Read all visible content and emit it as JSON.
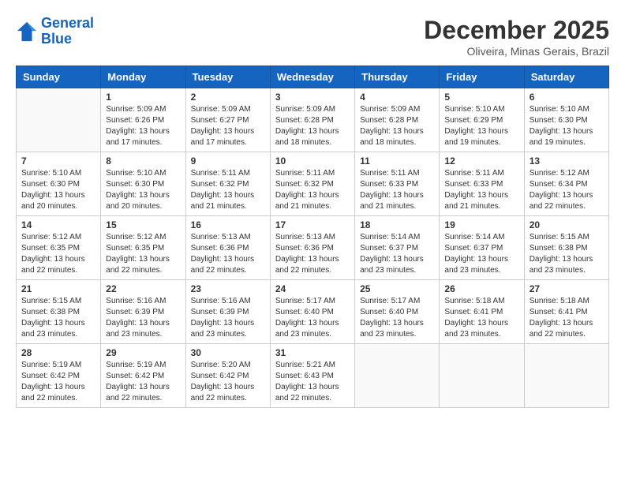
{
  "header": {
    "logo_line1": "General",
    "logo_line2": "Blue",
    "month": "December 2025",
    "location": "Oliveira, Minas Gerais, Brazil"
  },
  "weekdays": [
    "Sunday",
    "Monday",
    "Tuesday",
    "Wednesday",
    "Thursday",
    "Friday",
    "Saturday"
  ],
  "weeks": [
    [
      {
        "day": "",
        "sunrise": "",
        "sunset": "",
        "daylight": ""
      },
      {
        "day": "1",
        "sunrise": "Sunrise: 5:09 AM",
        "sunset": "Sunset: 6:26 PM",
        "daylight": "Daylight: 13 hours and 17 minutes."
      },
      {
        "day": "2",
        "sunrise": "Sunrise: 5:09 AM",
        "sunset": "Sunset: 6:27 PM",
        "daylight": "Daylight: 13 hours and 17 minutes."
      },
      {
        "day": "3",
        "sunrise": "Sunrise: 5:09 AM",
        "sunset": "Sunset: 6:28 PM",
        "daylight": "Daylight: 13 hours and 18 minutes."
      },
      {
        "day": "4",
        "sunrise": "Sunrise: 5:09 AM",
        "sunset": "Sunset: 6:28 PM",
        "daylight": "Daylight: 13 hours and 18 minutes."
      },
      {
        "day": "5",
        "sunrise": "Sunrise: 5:10 AM",
        "sunset": "Sunset: 6:29 PM",
        "daylight": "Daylight: 13 hours and 19 minutes."
      },
      {
        "day": "6",
        "sunrise": "Sunrise: 5:10 AM",
        "sunset": "Sunset: 6:30 PM",
        "daylight": "Daylight: 13 hours and 19 minutes."
      }
    ],
    [
      {
        "day": "7",
        "sunrise": "Sunrise: 5:10 AM",
        "sunset": "Sunset: 6:30 PM",
        "daylight": "Daylight: 13 hours and 20 minutes."
      },
      {
        "day": "8",
        "sunrise": "Sunrise: 5:10 AM",
        "sunset": "Sunset: 6:30 PM",
        "daylight": "Daylight: 13 hours and 20 minutes."
      },
      {
        "day": "9",
        "sunrise": "Sunrise: 5:11 AM",
        "sunset": "Sunset: 6:32 PM",
        "daylight": "Daylight: 13 hours and 21 minutes."
      },
      {
        "day": "10",
        "sunrise": "Sunrise: 5:11 AM",
        "sunset": "Sunset: 6:32 PM",
        "daylight": "Daylight: 13 hours and 21 minutes."
      },
      {
        "day": "11",
        "sunrise": "Sunrise: 5:11 AM",
        "sunset": "Sunset: 6:33 PM",
        "daylight": "Daylight: 13 hours and 21 minutes."
      },
      {
        "day": "12",
        "sunrise": "Sunrise: 5:11 AM",
        "sunset": "Sunset: 6:33 PM",
        "daylight": "Daylight: 13 hours and 21 minutes."
      },
      {
        "day": "13",
        "sunrise": "Sunrise: 5:12 AM",
        "sunset": "Sunset: 6:34 PM",
        "daylight": "Daylight: 13 hours and 22 minutes."
      }
    ],
    [
      {
        "day": "14",
        "sunrise": "Sunrise: 5:12 AM",
        "sunset": "Sunset: 6:35 PM",
        "daylight": "Daylight: 13 hours and 22 minutes."
      },
      {
        "day": "15",
        "sunrise": "Sunrise: 5:12 AM",
        "sunset": "Sunset: 6:35 PM",
        "daylight": "Daylight: 13 hours and 22 minutes."
      },
      {
        "day": "16",
        "sunrise": "Sunrise: 5:13 AM",
        "sunset": "Sunset: 6:36 PM",
        "daylight": "Daylight: 13 hours and 22 minutes."
      },
      {
        "day": "17",
        "sunrise": "Sunrise: 5:13 AM",
        "sunset": "Sunset: 6:36 PM",
        "daylight": "Daylight: 13 hours and 22 minutes."
      },
      {
        "day": "18",
        "sunrise": "Sunrise: 5:14 AM",
        "sunset": "Sunset: 6:37 PM",
        "daylight": "Daylight: 13 hours and 23 minutes."
      },
      {
        "day": "19",
        "sunrise": "Sunrise: 5:14 AM",
        "sunset": "Sunset: 6:37 PM",
        "daylight": "Daylight: 13 hours and 23 minutes."
      },
      {
        "day": "20",
        "sunrise": "Sunrise: 5:15 AM",
        "sunset": "Sunset: 6:38 PM",
        "daylight": "Daylight: 13 hours and 23 minutes."
      }
    ],
    [
      {
        "day": "21",
        "sunrise": "Sunrise: 5:15 AM",
        "sunset": "Sunset: 6:38 PM",
        "daylight": "Daylight: 13 hours and 23 minutes."
      },
      {
        "day": "22",
        "sunrise": "Sunrise: 5:16 AM",
        "sunset": "Sunset: 6:39 PM",
        "daylight": "Daylight: 13 hours and 23 minutes."
      },
      {
        "day": "23",
        "sunrise": "Sunrise: 5:16 AM",
        "sunset": "Sunset: 6:39 PM",
        "daylight": "Daylight: 13 hours and 23 minutes."
      },
      {
        "day": "24",
        "sunrise": "Sunrise: 5:17 AM",
        "sunset": "Sunset: 6:40 PM",
        "daylight": "Daylight: 13 hours and 23 minutes."
      },
      {
        "day": "25",
        "sunrise": "Sunrise: 5:17 AM",
        "sunset": "Sunset: 6:40 PM",
        "daylight": "Daylight: 13 hours and 23 minutes."
      },
      {
        "day": "26",
        "sunrise": "Sunrise: 5:18 AM",
        "sunset": "Sunset: 6:41 PM",
        "daylight": "Daylight: 13 hours and 23 minutes."
      },
      {
        "day": "27",
        "sunrise": "Sunrise: 5:18 AM",
        "sunset": "Sunset: 6:41 PM",
        "daylight": "Daylight: 13 hours and 22 minutes."
      }
    ],
    [
      {
        "day": "28",
        "sunrise": "Sunrise: 5:19 AM",
        "sunset": "Sunset: 6:42 PM",
        "daylight": "Daylight: 13 hours and 22 minutes."
      },
      {
        "day": "29",
        "sunrise": "Sunrise: 5:19 AM",
        "sunset": "Sunset: 6:42 PM",
        "daylight": "Daylight: 13 hours and 22 minutes."
      },
      {
        "day": "30",
        "sunrise": "Sunrise: 5:20 AM",
        "sunset": "Sunset: 6:42 PM",
        "daylight": "Daylight: 13 hours and 22 minutes."
      },
      {
        "day": "31",
        "sunrise": "Sunrise: 5:21 AM",
        "sunset": "Sunset: 6:43 PM",
        "daylight": "Daylight: 13 hours and 22 minutes."
      },
      {
        "day": "",
        "sunrise": "",
        "sunset": "",
        "daylight": ""
      },
      {
        "day": "",
        "sunrise": "",
        "sunset": "",
        "daylight": ""
      },
      {
        "day": "",
        "sunrise": "",
        "sunset": "",
        "daylight": ""
      }
    ]
  ]
}
